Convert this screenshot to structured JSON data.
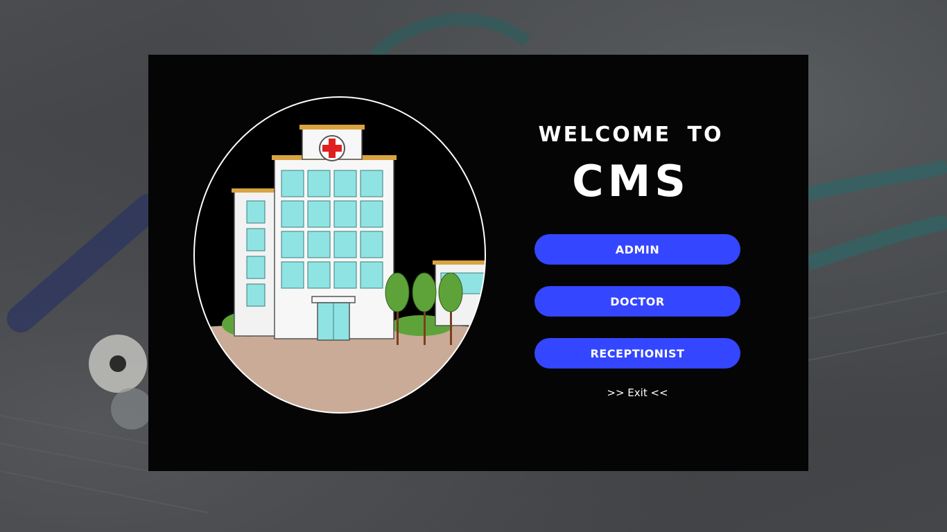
{
  "welcome": {
    "line1": "WELCOME  TO",
    "brand": "CMS"
  },
  "roles": {
    "admin_label": "ADMIN",
    "doctor_label": "DOCTOR",
    "receptionist_label": "RECEPTIONIST"
  },
  "exit_label": ">> Exit <<",
  "colors": {
    "panel": "#050505",
    "button": "#3446ff",
    "text": "#ffffff"
  },
  "icons": {
    "hero": "hospital-illustration",
    "cross": "medical-cross-icon"
  }
}
